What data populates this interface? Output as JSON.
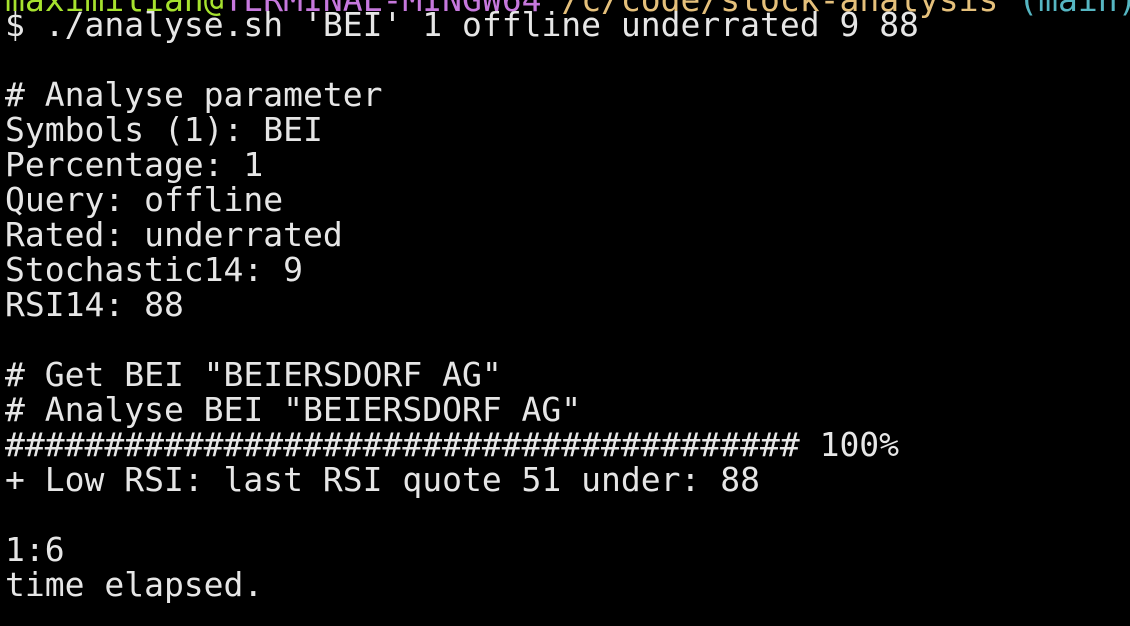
{
  "colors": {
    "background": "#000000",
    "foreground": "#e6e6e6",
    "prompt_user": "#a6e22e",
    "prompt_host": "#c678dd",
    "prompt_path": "#e5c07b",
    "prompt_branch": "#56b6c2"
  },
  "terminal": {
    "prompt_header": {
      "user": "maximilian",
      "at": "@",
      "host": "TERMINAL-MINGW64",
      "path": " /c/code/stock-analysis",
      "branch": " (main)"
    },
    "command_prompt": "$ ",
    "command": "./analyse.sh 'BEI' 1 offline underrated 9 88",
    "lines": [
      "# Analyse parameter",
      "Symbols (1): BEI",
      "Percentage: 1",
      "Query: offline",
      "Rated: underrated",
      "Stochastic14: 9",
      "RSI14: 88",
      "# Get BEI \"BEIERSDORF AG\"",
      "# Analyse BEI \"BEIERSDORF AG\"",
      "######################################## 100%",
      "+ Low RSI: last RSI quote 51 under: 88",
      "1:6",
      "time elapsed."
    ]
  }
}
